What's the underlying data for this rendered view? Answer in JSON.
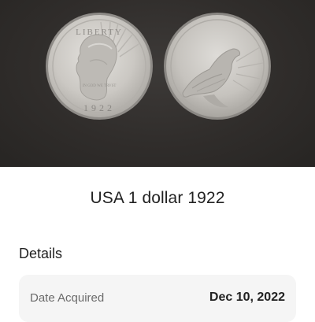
{
  "coin": {
    "title": "USA 1 dollar 1922",
    "obverse_legend": "LIBERTY",
    "obverse_motto": "IN GOD WE TRVST",
    "obverse_year": "1922"
  },
  "details": {
    "heading": "Details",
    "rows": [
      {
        "label": "Date Acquired",
        "value": "Dec 10, 2022"
      }
    ]
  },
  "colors": {
    "photo_background": "#2f2c2a",
    "coin_silver": "#cfcdc9",
    "card_background": "#f5f5f5"
  }
}
